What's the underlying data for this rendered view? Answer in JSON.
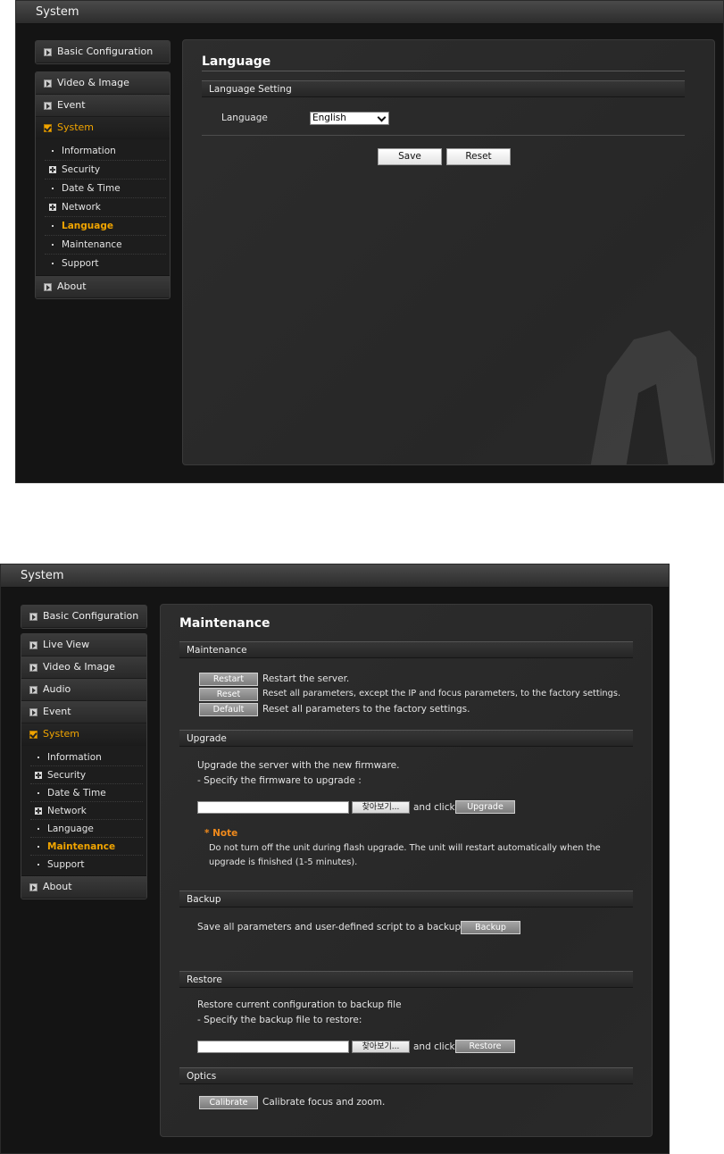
{
  "screen1": {
    "window_title": "System",
    "menu": {
      "basic": "Basic Configuration",
      "video": "Video & Image",
      "event": "Event",
      "system": "System",
      "about": "About",
      "sub": [
        "Information",
        "Security",
        "Date & Time",
        "Network",
        "Language",
        "Maintenance",
        "Support"
      ]
    },
    "page_title": "Language",
    "section": "Language Setting",
    "language_label": "Language",
    "language_value": "English",
    "save_label": "Save",
    "reset_label": "Reset"
  },
  "screen2": {
    "window_title": "System",
    "menu": {
      "basic": "Basic Configuration",
      "live": "Live View",
      "video": "Video & Image",
      "audio": "Audio",
      "event": "Event",
      "system": "System",
      "about": "About",
      "sub": [
        "Information",
        "Security",
        "Date & Time",
        "Network",
        "Language",
        "Maintenance",
        "Support"
      ]
    },
    "page_title": "Maintenance",
    "maintenance": {
      "header": "Maintenance",
      "restart_label": "Restart",
      "restart_desc": "Restart the server.",
      "reset_label": "Reset",
      "reset_desc": "Reset all parameters, except the IP and focus parameters, to the factory settings.",
      "default_label": "Default",
      "default_desc": "Reset all parameters to the factory settings."
    },
    "upgrade": {
      "header": "Upgrade",
      "line1": "Upgrade the server with the new firmware.",
      "line2": "- Specify the firmware to upgrade :",
      "browse_label": "찾아보기...",
      "and_click": "and click",
      "upgrade_label": "Upgrade",
      "note_title": "* Note",
      "note_line1": "Do not turn off the unit during flash upgrade. The unit will restart automatically when the",
      "note_line2": "upgrade is finished (1-5 minutes)."
    },
    "backup": {
      "header": "Backup",
      "desc": "Save all parameters and user-defined script to a backup file.",
      "backup_label": "Backup"
    },
    "restore": {
      "header": "Restore",
      "line1": "Restore current configuration to backup file",
      "line2": "- Specify the backup file to restore:",
      "browse_label": "찾아보기...",
      "and_click": "and click",
      "restore_label": "Restore"
    },
    "optics": {
      "header": "Optics",
      "calibrate_label": "Calibrate",
      "calibrate_desc": "Calibrate focus and zoom."
    }
  }
}
